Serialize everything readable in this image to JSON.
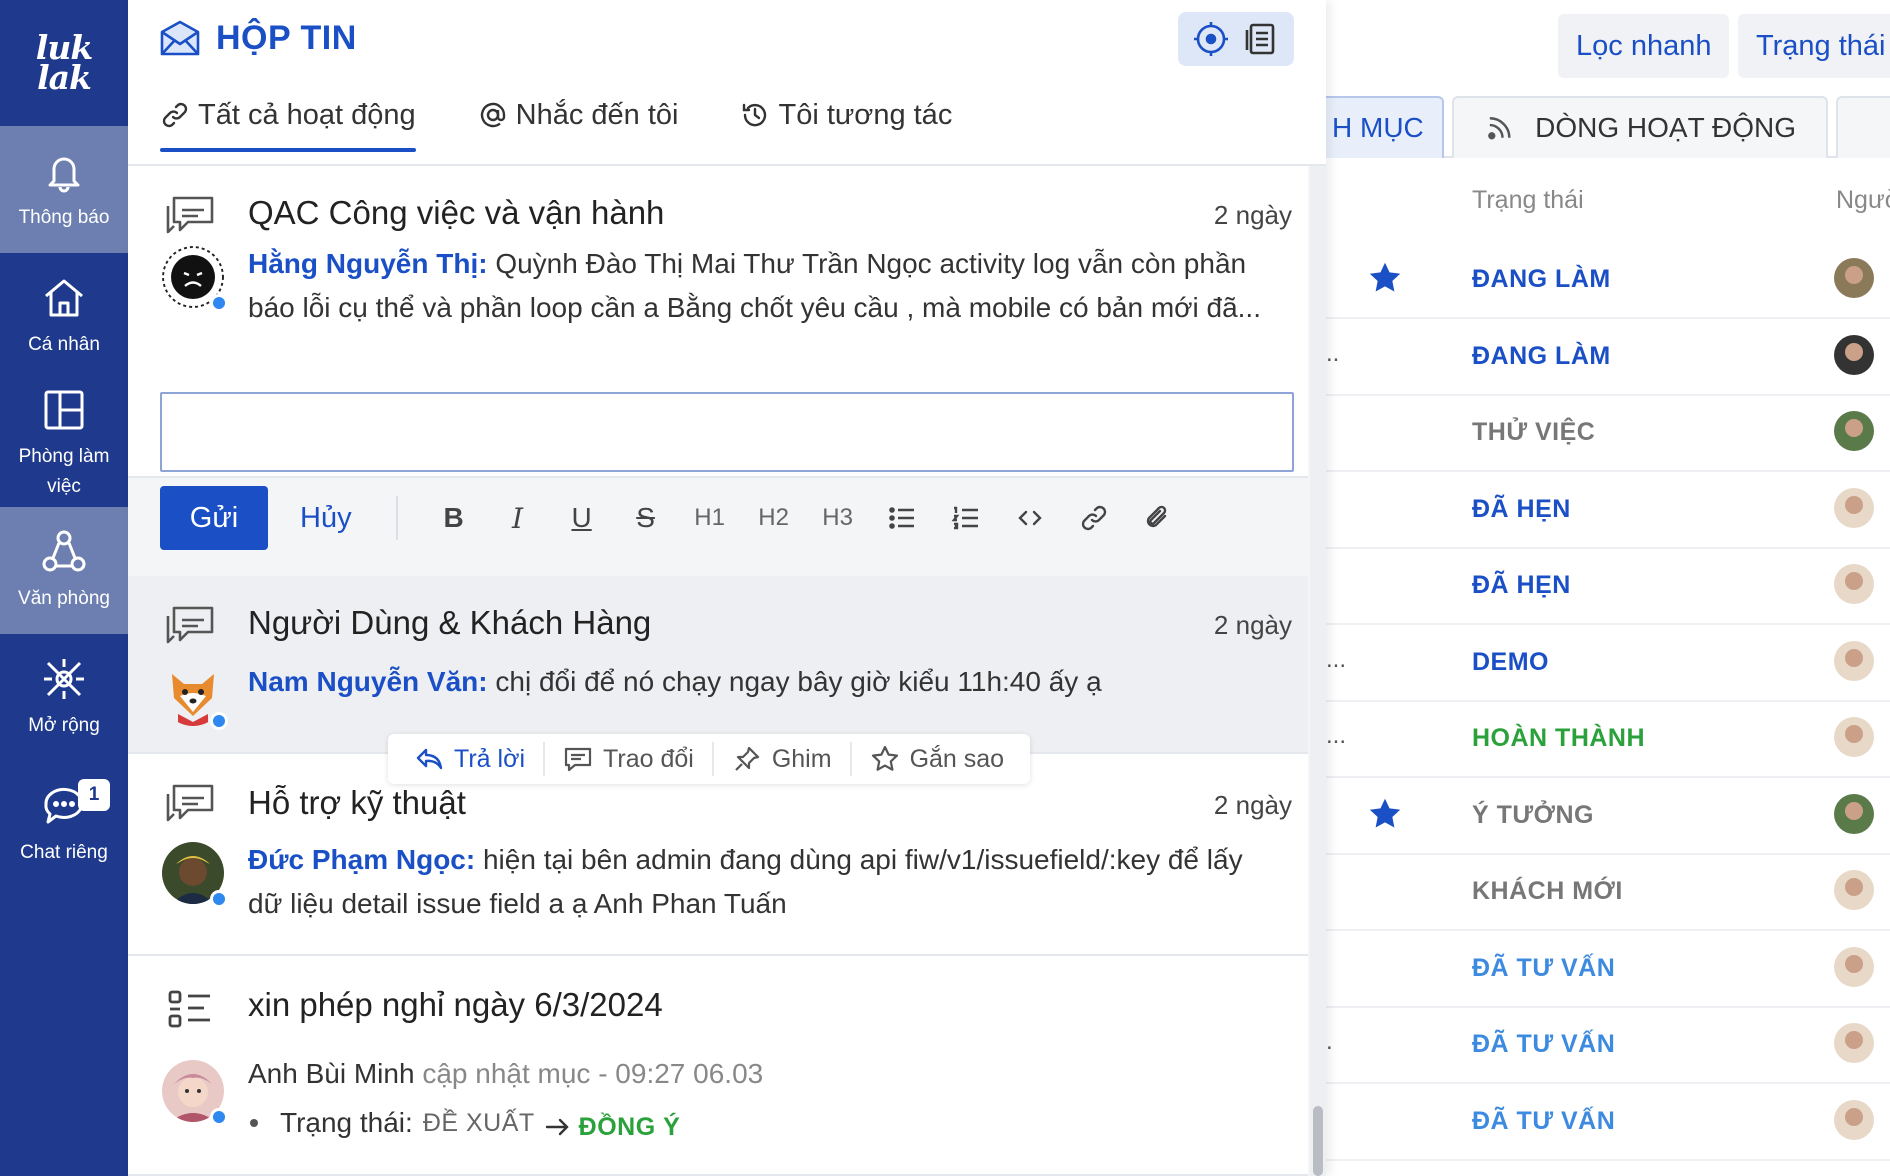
{
  "rail": {
    "logo": "luk\nlak",
    "items": [
      {
        "label": "Thông báo",
        "active": true
      },
      {
        "label": "Cá nhân",
        "active": false
      },
      {
        "label": "Phòng làm\nviệc",
        "active": false
      },
      {
        "label": "Văn phòng",
        "active": true
      },
      {
        "label": "Mở rộng",
        "active": false
      },
      {
        "label": "Chat riêng",
        "active": false,
        "badge": "1"
      }
    ]
  },
  "inbox": {
    "title": "HỘP TIN",
    "tabs": [
      "Tất cả hoạt động",
      "Nhắc đến tôi",
      "Tôi tương tác"
    ],
    "cards": [
      {
        "title": "QAC Công việc và vận hành",
        "time": "2 ngày",
        "author": "Hằng Nguyễn Thị:",
        "message": " Quỳnh Đào Thị Mai Thư Trần Ngọc activity log vẫn còn phần báo lỗi cụ thể và phần loop cần a Bằng chốt yêu cầu , mà mobile có bản mới đã..."
      },
      {
        "title": "Người Dùng & Khách Hàng",
        "time": "2 ngày",
        "author": "Nam Nguyễn Văn:",
        "message": " chị đổi để nó chạy ngay bây giờ kiểu 11h:40 ấy ạ"
      },
      {
        "title": "Hỗ trợ kỹ thuật",
        "time": "2 ngày",
        "author": "Đức Phạm Ngọc:",
        "message": " hiện tại bên admin đang dùng api fiw/v1/issuefield/:key để lấy dữ liệu detail issue field a ạ Anh Phan Tuấn"
      },
      {
        "title": "xin phép nghỉ ngày 6/3/2024",
        "author": "Anh Bùi Minh",
        "update": " cập nhật mục - 09:27 06.03",
        "field": "Trạng thái:",
        "from": "ĐỀ XUẤT",
        "to": "ĐỒNG Ý"
      }
    ],
    "composer": {
      "send": "Gửi",
      "cancel": "Hủy",
      "tools": [
        "B",
        "I",
        "U",
        "S",
        "H1",
        "H2",
        "H3"
      ]
    },
    "actions": [
      "Trả lời",
      "Trao đổi",
      "Ghim",
      "Gắn sao"
    ]
  },
  "background": {
    "buttons": [
      "Lọc nhanh",
      "Trạng thái"
    ],
    "tabs": [
      "H MỤC",
      "DÒNG HOẠT ĐỘNG"
    ],
    "columns": [
      "Trạng thái",
      "Ngườ"
    ],
    "rows": [
      {
        "dots": "",
        "star": true,
        "status": "ĐANG LÀM",
        "color": "#1a4fc6"
      },
      {
        "dots": "..",
        "star": false,
        "status": "ĐANG LÀM",
        "color": "#1a4fc6"
      },
      {
        "dots": "",
        "star": false,
        "status": "THỬ VIỆC",
        "color": "#777777"
      },
      {
        "dots": "",
        "star": false,
        "status": "ĐÃ HẸN",
        "color": "#1a4fc6"
      },
      {
        "dots": "",
        "star": false,
        "status": "ĐÃ HẸN",
        "color": "#1a4fc6"
      },
      {
        "dots": "...",
        "star": false,
        "status": "DEMO",
        "color": "#1a4fc6"
      },
      {
        "dots": "...",
        "star": false,
        "status": "HOÀN THÀNH",
        "color": "#2aa13a"
      },
      {
        "dots": "",
        "star": true,
        "status": "Ý TƯỞNG",
        "color": "#777777"
      },
      {
        "dots": "",
        "star": false,
        "status": "KHÁCH MỚI",
        "color": "#777777"
      },
      {
        "dots": "",
        "star": false,
        "status": "ĐÃ TƯ VẤN",
        "color": "#3d8be0"
      },
      {
        "dots": ".",
        "star": false,
        "status": "ĐÃ TƯ VẤN",
        "color": "#3d8be0"
      },
      {
        "dots": "",
        "star": false,
        "status": "ĐÃ TƯ VẤN",
        "color": "#3d8be0"
      }
    ]
  }
}
